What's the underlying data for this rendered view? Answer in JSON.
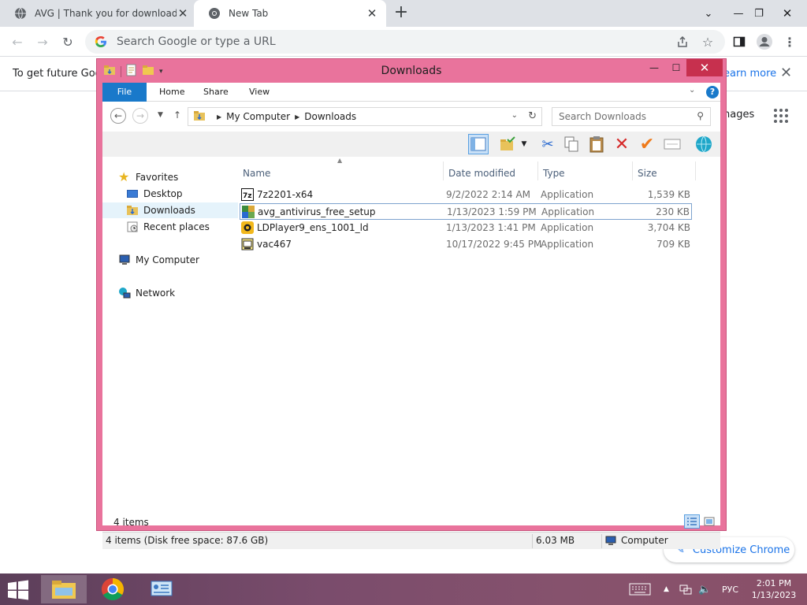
{
  "chrome": {
    "tabs": [
      {
        "title": "AVG | Thank you for downloading",
        "active": false
      },
      {
        "title": "New Tab",
        "active": true
      }
    ],
    "omnibox_placeholder": "Search Google or type a URL",
    "infobar": {
      "text": "To get future Goog",
      "link": "earn more"
    },
    "ntp_images": "nages",
    "customize_label": "Customize Chrome"
  },
  "explorer": {
    "title": "Downloads",
    "ribbon_tabs": [
      "File",
      "Home",
      "Share",
      "View"
    ],
    "breadcrumb": [
      "My Computer",
      "Downloads"
    ],
    "search_placeholder": "Search Downloads",
    "nav": {
      "favorites": "Favorites",
      "desktop": "Desktop",
      "downloads": "Downloads",
      "recent": "Recent places",
      "computer": "My Computer",
      "network": "Network"
    },
    "columns": {
      "name": "Name",
      "date": "Date modified",
      "type": "Type",
      "size": "Size"
    },
    "files": [
      {
        "name": "7z2201-x64",
        "date": "9/2/2022 2:14 AM",
        "type": "Application",
        "size": "1,539 KB",
        "icon": "7zip-icon"
      },
      {
        "name": "avg_antivirus_free_setup",
        "date": "1/13/2023 1:59 PM",
        "type": "Application",
        "size": "230 KB",
        "icon": "installer-icon",
        "selected": true
      },
      {
        "name": "LDPlayer9_ens_1001_ld",
        "date": "1/13/2023 1:41 PM",
        "type": "Application",
        "size": "3,704 KB",
        "icon": "ldplayer-icon"
      },
      {
        "name": "vac467",
        "date": "10/17/2022 9:45 PM",
        "type": "Application",
        "size": "709 KB",
        "icon": "app-icon"
      }
    ],
    "item_count": "4 items",
    "status": {
      "left": "4 items (Disk free space: 87.6 GB)",
      "size": "6.03 MB",
      "location": "Computer"
    }
  },
  "taskbar": {
    "lang": "РУС",
    "time": "2:01 PM",
    "date": "1/13/2023"
  },
  "colors": {
    "explorer_frame": "#e9739c",
    "close_button": "#c7304e",
    "ribbon_file": "#1979ca",
    "chrome_link": "#1a73e8"
  }
}
